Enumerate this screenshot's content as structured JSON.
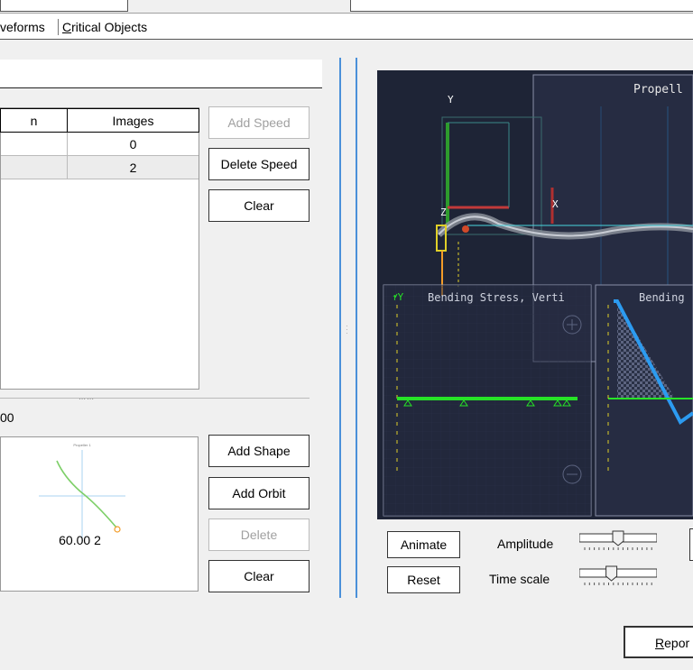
{
  "tabs": [
    {
      "label_rest": "veforms"
    },
    {
      "label_first": "C",
      "label_rest": "ritical Objects"
    }
  ],
  "speed_table": {
    "col_left": "n",
    "col_images": "Images",
    "rows": [
      {
        "images": "0"
      },
      {
        "images": "2"
      }
    ]
  },
  "speed_buttons": {
    "add": "Add Speed",
    "delete": "Delete Speed",
    "clear": "Clear"
  },
  "orbit_section": {
    "value_label": "00",
    "thumb_title": "Propeller 1",
    "thumb_caption": "60.00 2"
  },
  "shape_buttons": {
    "add_shape": "Add Shape",
    "add_orbit": "Add Orbit",
    "delete": "Delete",
    "clear": "Clear"
  },
  "viewport": {
    "main_title": "Propell",
    "axis_y": "Y",
    "axis_x": "X",
    "axis_z": "Z",
    "panel1_title": "Bending Stress, Verti",
    "panel2_title": "Bending",
    "panel_axis_y": "Y"
  },
  "animation": {
    "animate": "Animate",
    "reset": "Reset",
    "amplitude": "Amplitude",
    "time_scale": "Time scale",
    "amplitude_level": 0.5,
    "time_scale_level": 0.4
  },
  "report_button": {
    "first": "R",
    "rest": "epor"
  },
  "colors": {
    "viewport_bg": "#1e2436",
    "stress_green": "#27e327",
    "stress_blue": "#2c9bf0",
    "splitter_blue": "#4a90d9"
  }
}
